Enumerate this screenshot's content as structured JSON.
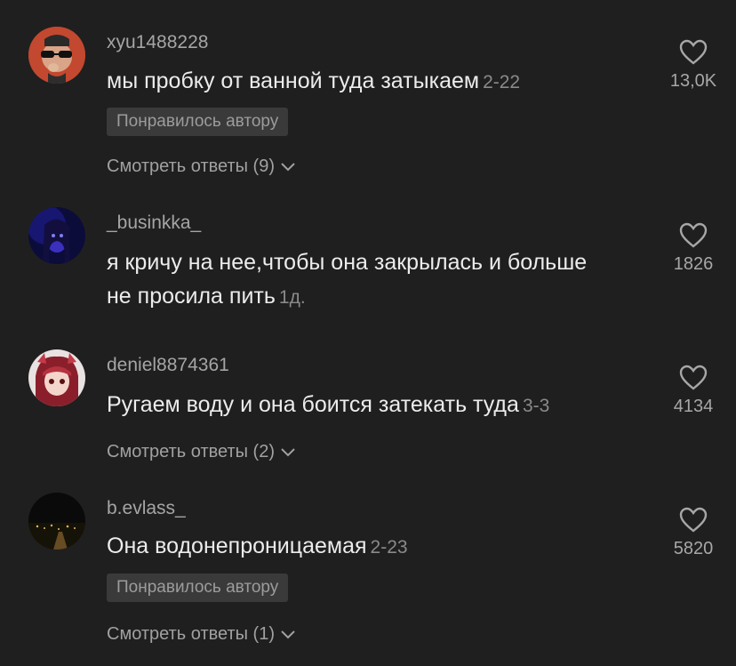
{
  "comments": [
    {
      "username": "xyu1488228",
      "text": "мы пробку от ванной туда затыкаем",
      "date": "2-22",
      "badge": "Понравилось автору",
      "replies": "Смотреть ответы (9)",
      "likes": "13,0K",
      "avatar_icon": "user-avatar-sunglasses"
    },
    {
      "username": "_businkka_",
      "text": "я кричу на нее,чтобы она закрылась и больше не просила пить",
      "date": "1д.",
      "likes": "1826",
      "avatar_icon": "user-avatar-blue-portrait"
    },
    {
      "username": "deniel8874361",
      "text": "Ругаем воду и она боится затекать туда",
      "date": "3-3",
      "replies": "Смотреть ответы (2)",
      "likes": "4134",
      "avatar_icon": "user-avatar-anime"
    },
    {
      "username": "b.evlass_",
      "text": "Она водонепроницаемая",
      "date": "2-23",
      "badge": "Понравилось автору",
      "replies": "Смотреть ответы (1)",
      "likes": "5820",
      "avatar_icon": "user-avatar-night-city"
    }
  ],
  "colors": {
    "background": "#1f1f1f",
    "text": "#ececec",
    "muted": "#a5a5a5",
    "badge_bg": "#3a3a3a"
  }
}
